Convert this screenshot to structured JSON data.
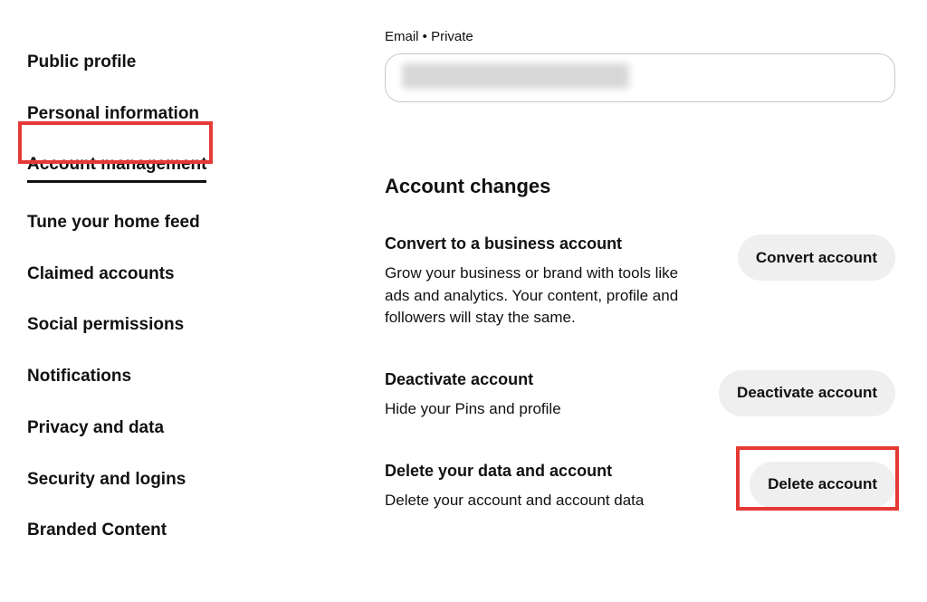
{
  "sidebar": {
    "items": [
      {
        "label": "Public profile"
      },
      {
        "label": "Personal information"
      },
      {
        "label": "Account management"
      },
      {
        "label": "Tune your home feed"
      },
      {
        "label": "Claimed accounts"
      },
      {
        "label": "Social permissions"
      },
      {
        "label": "Notifications"
      },
      {
        "label": "Privacy and data"
      },
      {
        "label": "Security and logins"
      },
      {
        "label": "Branded Content"
      }
    ]
  },
  "emailField": {
    "label": "Email • Private",
    "value": ""
  },
  "section": {
    "title": "Account changes"
  },
  "changes": {
    "convert": {
      "heading": "Convert to a business account",
      "desc": "Grow your business or brand with tools like ads and analytics. Your content, profile and followers will stay the same.",
      "button": "Convert account"
    },
    "deactivate": {
      "heading": "Deactivate account",
      "desc": "Hide your Pins and profile",
      "button": "Deactivate account"
    },
    "delete": {
      "heading": "Delete your data and account",
      "desc": "Delete your account and account data",
      "button": "Delete account"
    }
  }
}
